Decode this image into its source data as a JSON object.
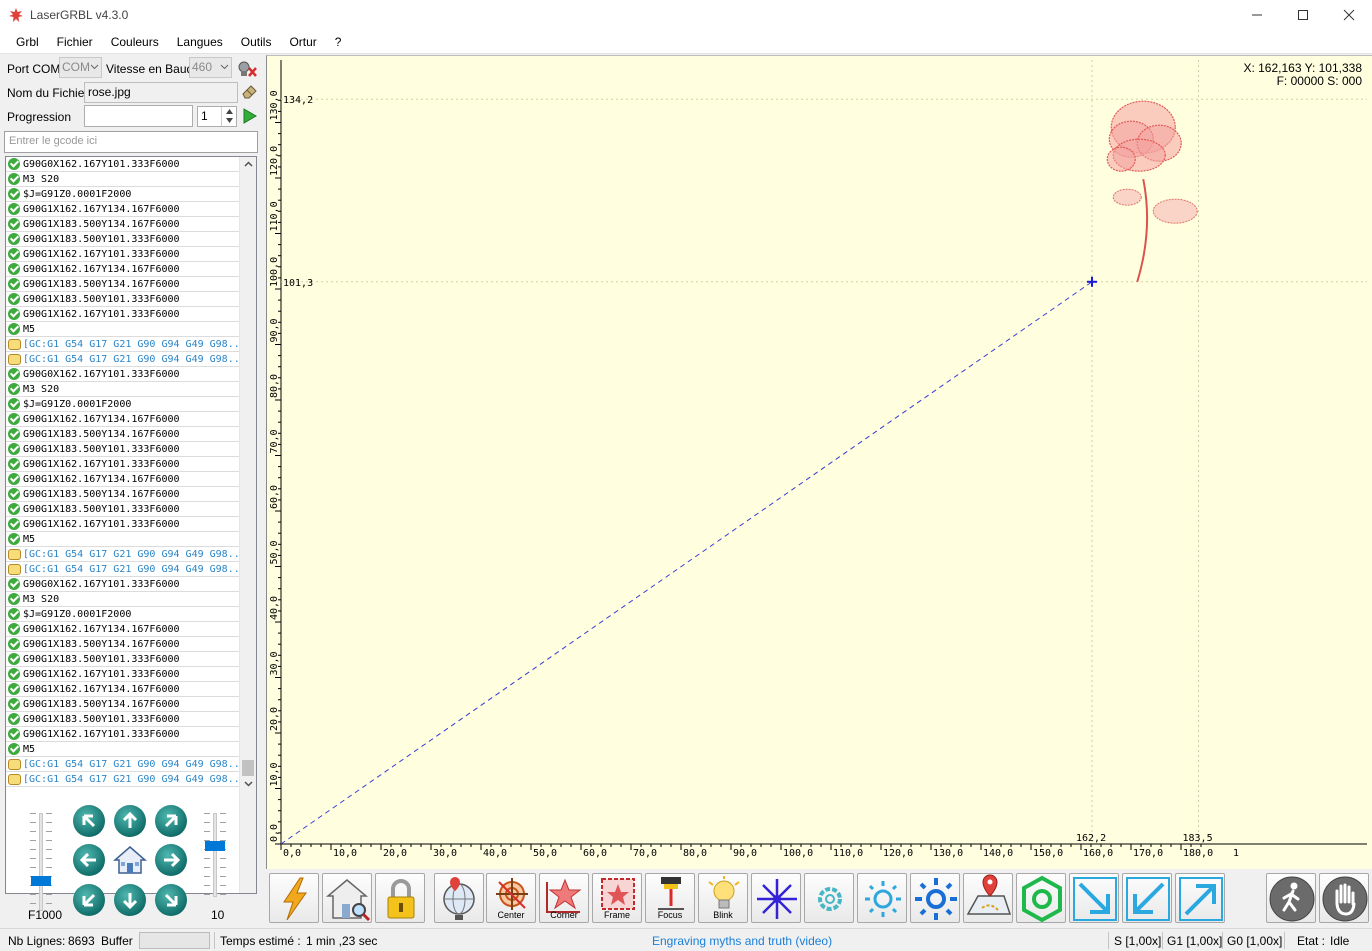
{
  "window": {
    "title": "LaserGRBL v4.3.0"
  },
  "menu": [
    "Grbl",
    "Fichier",
    "Couleurs",
    "Langues",
    "Outils",
    "Ortur",
    "?"
  ],
  "connection": {
    "port_label": "Port COM",
    "port_value": "COM",
    "baud_label": "Vitesse en Baud",
    "baud_value": "460"
  },
  "file": {
    "label": "Nom du Fichier",
    "value": "rose.jpg"
  },
  "progress": {
    "label": "Progression",
    "passes": "1"
  },
  "gcode_input": {
    "placeholder": "Entrer le gcode ici"
  },
  "log": [
    {
      "ok": true,
      "text": "G90G0X162.167Y101.333F6000"
    },
    {
      "ok": true,
      "text": "M3 S20"
    },
    {
      "ok": true,
      "text": "$J=G91Z0.0001F2000"
    },
    {
      "ok": true,
      "text": "G90G1X162.167Y134.167F6000"
    },
    {
      "ok": true,
      "text": "G90G1X183.500Y134.167F6000"
    },
    {
      "ok": true,
      "text": "G90G1X183.500Y101.333F6000"
    },
    {
      "ok": true,
      "text": "G90G1X162.167Y101.333F6000"
    },
    {
      "ok": true,
      "text": "G90G1X162.167Y134.167F6000"
    },
    {
      "ok": true,
      "text": "G90G1X183.500Y134.167F6000"
    },
    {
      "ok": true,
      "text": "G90G1X183.500Y101.333F6000"
    },
    {
      "ok": true,
      "text": "G90G1X162.167Y101.333F6000"
    },
    {
      "ok": true,
      "text": "M5"
    },
    {
      "ok": false,
      "text": "[GC:G1 G54 G17 G21 G90 G94 G49 G98..."
    },
    {
      "ok": false,
      "text": "[GC:G1 G54 G17 G21 G90 G94 G49 G98..."
    },
    {
      "ok": true,
      "text": "G90G0X162.167Y101.333F6000"
    },
    {
      "ok": true,
      "text": "M3 S20"
    },
    {
      "ok": true,
      "text": "$J=G91Z0.0001F2000"
    },
    {
      "ok": true,
      "text": "G90G1X162.167Y134.167F6000"
    },
    {
      "ok": true,
      "text": "G90G1X183.500Y134.167F6000"
    },
    {
      "ok": true,
      "text": "G90G1X183.500Y101.333F6000"
    },
    {
      "ok": true,
      "text": "G90G1X162.167Y101.333F6000"
    },
    {
      "ok": true,
      "text": "G90G1X162.167Y134.167F6000"
    },
    {
      "ok": true,
      "text": "G90G1X183.500Y134.167F6000"
    },
    {
      "ok": true,
      "text": "G90G1X183.500Y101.333F6000"
    },
    {
      "ok": true,
      "text": "G90G1X162.167Y101.333F6000"
    },
    {
      "ok": true,
      "text": "M5"
    },
    {
      "ok": false,
      "text": "[GC:G1 G54 G17 G21 G90 G94 G49 G98..."
    },
    {
      "ok": false,
      "text": "[GC:G1 G54 G17 G21 G90 G94 G49 G98..."
    },
    {
      "ok": true,
      "text": "G90G0X162.167Y101.333F6000"
    },
    {
      "ok": true,
      "text": "M3 S20"
    },
    {
      "ok": true,
      "text": "$J=G91Z0.0001F2000"
    },
    {
      "ok": true,
      "text": "G90G1X162.167Y134.167F6000"
    },
    {
      "ok": true,
      "text": "G90G1X183.500Y134.167F6000"
    },
    {
      "ok": true,
      "text": "G90G1X183.500Y101.333F6000"
    },
    {
      "ok": true,
      "text": "G90G1X162.167Y101.333F6000"
    },
    {
      "ok": true,
      "text": "G90G1X162.167Y134.167F6000"
    },
    {
      "ok": true,
      "text": "G90G1X183.500Y134.167F6000"
    },
    {
      "ok": true,
      "text": "G90G1X183.500Y101.333F6000"
    },
    {
      "ok": true,
      "text": "G90G1X162.167Y101.333F6000"
    },
    {
      "ok": true,
      "text": "M5"
    },
    {
      "ok": false,
      "text": "[GC:G1 G54 G17 G21 G90 G94 G49 G98..."
    },
    {
      "ok": false,
      "text": "[GC:G1 G54 G17 G21 G90 G94 G49 G98..."
    }
  ],
  "jog": {
    "speed_label": "F1000",
    "step_label": "10",
    "speed_level": 0.28,
    "step_level": 0.62
  },
  "preview": {
    "readout_line1": "X: 162,163 Y: 101,338",
    "readout_line2": "F: 00000 S: 000",
    "x_ticks": [
      "0,0",
      "10,0",
      "20,0",
      "30,0",
      "40,0",
      "50,0",
      "60,0",
      "70,0",
      "80,0",
      "90,0",
      "100,0",
      "110,0",
      "120,0",
      "130,0",
      "140,0",
      "150,0",
      "160,0",
      "170,0",
      "180,0",
      "1"
    ],
    "y_ticks": [
      "0,0",
      "10,0",
      "20,0",
      "30,0",
      "40,0",
      "50,0",
      "60,0",
      "70,0",
      "80,0",
      "90,0",
      "100,0",
      "110,0",
      "120,0",
      "130,0"
    ],
    "y_marks": [
      "134,2",
      "101,3"
    ],
    "x_marks": [
      "162,2",
      "183,5"
    ],
    "x_max": 185,
    "y_max": 135,
    "image_x": [
      162.2,
      183.5
    ],
    "image_y": [
      101.3,
      134.2
    ],
    "cursor": {
      "x": 162.2,
      "y": 101.3
    }
  },
  "toolbar": {
    "center": "Center",
    "corner": "Corner",
    "frame": "Frame",
    "focus": "Focus",
    "blink": "Blink"
  },
  "colors": {
    "accent": "#0078d7",
    "jog": "#137c76",
    "preview_bg": "#ffffe0",
    "ok": "#3daa3d",
    "info": "#2b86c8"
  },
  "status": {
    "lines_label": "Nb Lignes:",
    "lines_value": "8693",
    "buffer_label": "Buffer",
    "time_label": "Temps estimé :",
    "time_value": "1 min ,23 sec",
    "link": "Engraving myths and truth (video)",
    "s": "S [1,00x]",
    "g1": "G1 [1,00x]",
    "g0": "G0 [1,00x]",
    "state_label": "Etat :",
    "state_value": "Idle"
  }
}
